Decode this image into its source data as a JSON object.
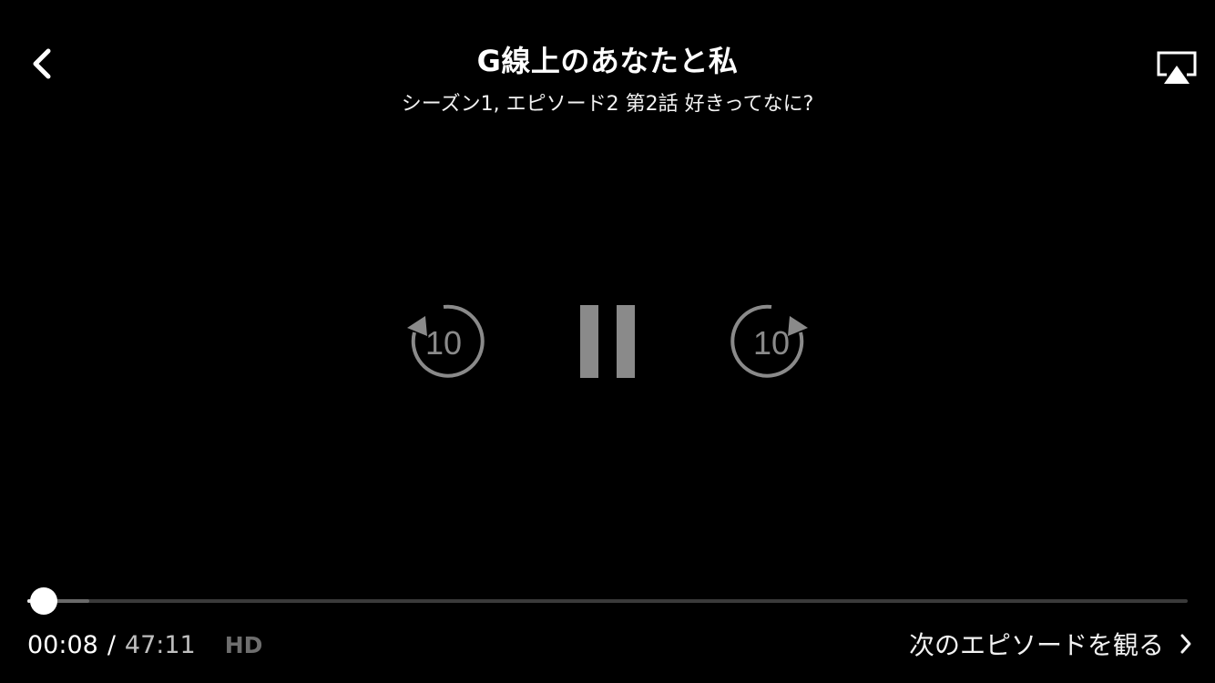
{
  "header": {
    "title": "G線上のあなたと私",
    "subtitle": "シーズン1, エピソード2 第2話 好きってなに?"
  },
  "icons": {
    "back": "chevron-left-icon",
    "airplay": "airplay-icon",
    "rewind": "rewind-10-icon",
    "pause": "pause-icon",
    "forward": "forward-10-icon",
    "next": "chevron-right-icon"
  },
  "controls": {
    "rewind_label": "10",
    "forward_label": "10"
  },
  "playback": {
    "current_time": "00:08",
    "separator": "/",
    "total_time": "47:11",
    "quality": "HD",
    "progress_fraction": 0.0028,
    "buffered_fraction": 0.053
  },
  "next_episode": {
    "label": "次のエピソードを観る"
  },
  "colors": {
    "background": "#000000",
    "foreground": "#ffffff",
    "control_gray": "#8a8a8a",
    "track": "#3a3a3a",
    "buffered": "#6a6a6a",
    "hd_badge": "#6e6e6e"
  }
}
